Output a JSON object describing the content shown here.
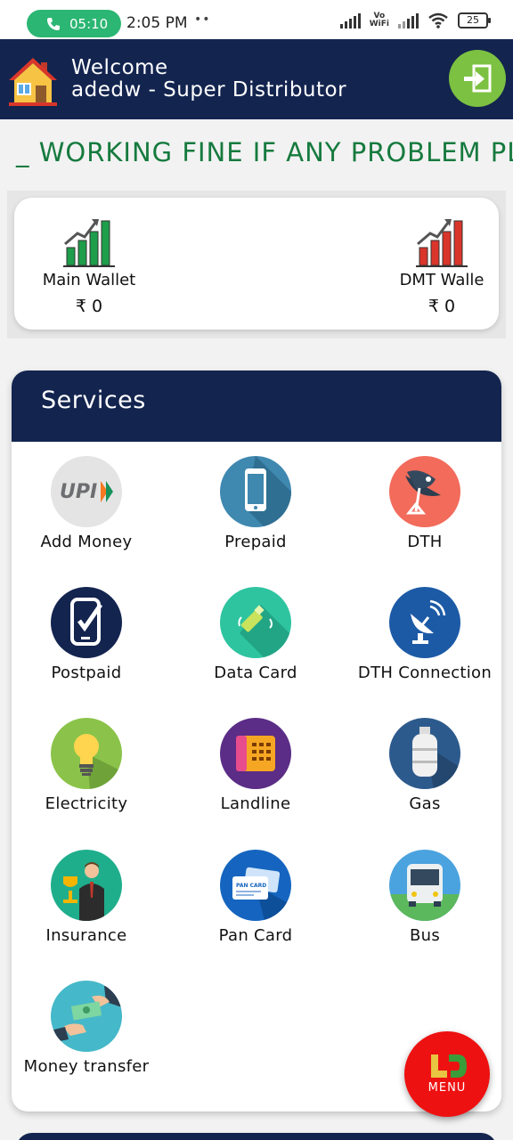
{
  "status_bar": {
    "call_time": "05:10",
    "time": "2:05 PM",
    "dots": "••",
    "vowifi": [
      "Vo",
      "WiFi"
    ],
    "battery": "25"
  },
  "header": {
    "welcome": "Welcome",
    "user": "adedw - Super Distributor"
  },
  "marquee": {
    "text": "_ WORKING FINE IF ANY PROBLEM PL"
  },
  "wallets": {
    "main": {
      "label": "Main Wallet",
      "amount": "₹ 0"
    },
    "dmt": {
      "label": "DMT Walle",
      "amount": "₹ 0"
    }
  },
  "services": {
    "title": "Services",
    "items": [
      {
        "label": "Add Money",
        "icon": "upi-icon"
      },
      {
        "label": "Prepaid",
        "icon": "mobile-phone-icon"
      },
      {
        "label": "DTH",
        "icon": "satellite-dish-icon"
      },
      {
        "label": "Postpaid",
        "icon": "mobile-check-icon"
      },
      {
        "label": "Data Card",
        "icon": "usb-datacard-icon"
      },
      {
        "label": "DTH Connection",
        "icon": "dish-antenna-icon"
      },
      {
        "label": "Electricity",
        "icon": "light-bulb-icon"
      },
      {
        "label": "Landline",
        "icon": "landline-phone-icon"
      },
      {
        "label": "Gas",
        "icon": "gas-cylinder-icon"
      },
      {
        "label": "Insurance",
        "icon": "insurance-agent-icon"
      },
      {
        "label": "Pan Card",
        "icon": "pan-card-icon"
      },
      {
        "label": "Bus",
        "icon": "bus-icon"
      },
      {
        "label": "Money transfer",
        "icon": "money-transfer-icon"
      }
    ]
  },
  "pan_card_text": "PAN CARD",
  "upi_text": "UPI",
  "menu": {
    "label": "MENU"
  },
  "colors": {
    "navy": "#13244f",
    "green_marquee": "#167a3e",
    "menu_red": "#ee1111",
    "logout_green": "#7cc142"
  }
}
